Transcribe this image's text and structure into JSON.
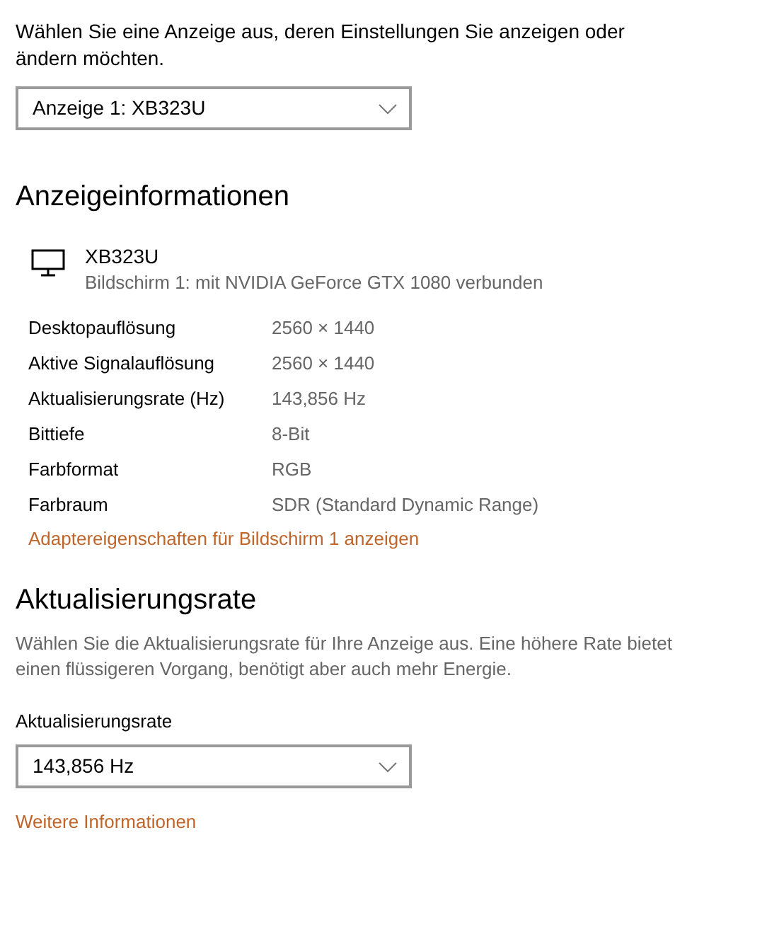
{
  "display_select": {
    "intro": "Wählen Sie eine Anzeige aus, deren Einstellungen Sie anzeigen oder ändern möchten.",
    "value": "Anzeige 1: XB323U"
  },
  "display_info": {
    "heading": "Anzeigeinformationen",
    "monitor_name": "XB323U",
    "monitor_subtitle": "Bildschirm 1: mit NVIDIA GeForce GTX 1080 verbunden",
    "rows": [
      {
        "label": "Desktopauflösung",
        "value": "2560 × 1440"
      },
      {
        "label": "Aktive Signalauflösung",
        "value": "2560 × 1440"
      },
      {
        "label": "Aktualisierungsrate (Hz)",
        "value": "143,856 Hz"
      },
      {
        "label": "Bittiefe",
        "value": "8-Bit"
      },
      {
        "label": "Farbformat",
        "value": "RGB"
      },
      {
        "label": "Farbraum",
        "value": "SDR (Standard Dynamic Range)"
      }
    ],
    "link": "Adaptereigenschaften für Bildschirm 1 anzeigen"
  },
  "refresh_rate": {
    "heading": "Aktualisierungsrate",
    "description": "Wählen Sie die Aktualisierungsrate für Ihre Anzeige aus. Eine höhere Rate bietet einen flüssigeren Vorgang, benötigt aber auch mehr Energie.",
    "field_label": "Aktualisierungsrate",
    "value": "143,856 Hz",
    "link": "Weitere Informationen"
  }
}
